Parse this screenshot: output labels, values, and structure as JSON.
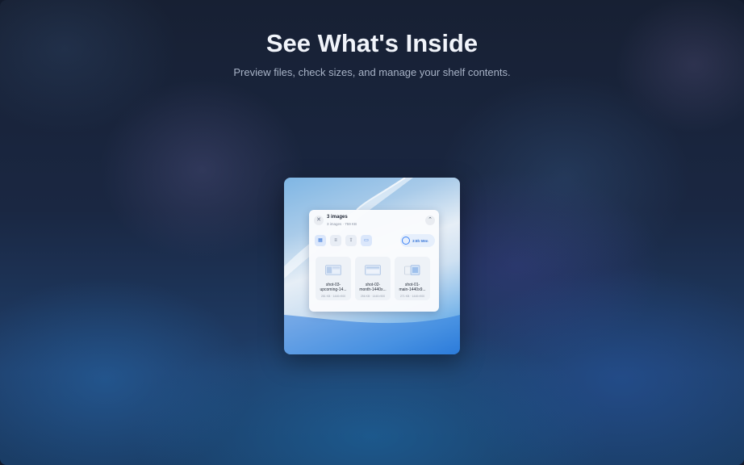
{
  "hero": {
    "title": "See What's Inside",
    "subtitle": "Preview files, check sizes, and manage your shelf contents."
  },
  "shelf": {
    "title": "3 images",
    "meta": "3 images · 759 KB",
    "timer": "3:8h 59m",
    "toolbar": [
      {
        "icon": "grid-view-icon",
        "active": true
      },
      {
        "icon": "list-view-icon",
        "active": false
      },
      {
        "icon": "share-icon",
        "active": false
      },
      {
        "icon": "folder-icon",
        "active": false
      }
    ],
    "files": [
      {
        "name": "shot-03-\nupcoming-14...",
        "size": "281 KB · 1440×900"
      },
      {
        "name": "shot-02-\nmonth-1440x...",
        "size": "256 KB · 1440×900"
      },
      {
        "name": "shot-01-\nmain-1440x9...",
        "size": "271 KB · 1440×900"
      }
    ]
  },
  "colors": {
    "accent": "#3b82f6",
    "background": "#172033",
    "title": "#f1f4fa",
    "subtitle": "#a7b2c6"
  }
}
